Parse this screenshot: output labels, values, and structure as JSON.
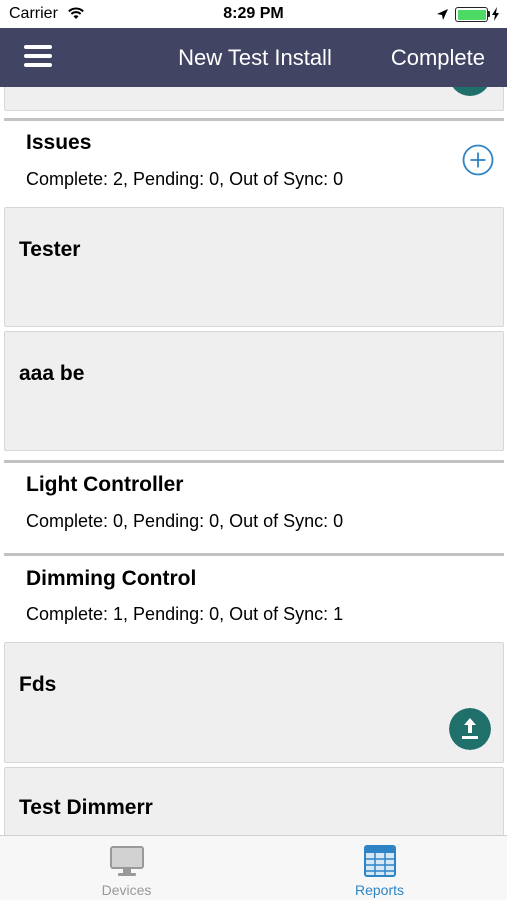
{
  "status_bar": {
    "carrier": "Carrier",
    "time": "8:29 PM"
  },
  "nav": {
    "title": "New Test Install",
    "complete_label": "Complete",
    "color": "#414563"
  },
  "sections": [
    {
      "title": "Issues",
      "stats": "Complete: 2, Pending: 0, Out of Sync: 0",
      "items": [
        {
          "title": "Tester"
        },
        {
          "title": "aaa be"
        }
      ]
    },
    {
      "title": "Light Controller",
      "stats": "Complete: 0, Pending: 0, Out of Sync: 0",
      "items": []
    },
    {
      "title": "Dimming Control",
      "stats": "Complete: 1, Pending: 0, Out of Sync: 1",
      "items": [
        {
          "title": "Fds"
        },
        {
          "title": "Test Dimmerr"
        }
      ]
    }
  ],
  "tab_bar": {
    "tabs": [
      {
        "label": "Devices",
        "active": false
      },
      {
        "label": "Reports",
        "active": true
      }
    ],
    "active_color": "#2f84c6",
    "inactive_color": "#999999"
  }
}
